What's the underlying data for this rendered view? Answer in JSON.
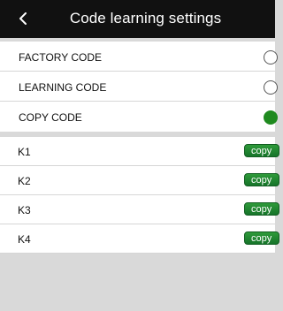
{
  "header": {
    "title": "Code learning settings",
    "back_icon": "chevron-left-icon"
  },
  "code_modes": [
    {
      "label": "FACTORY CODE",
      "selected": false
    },
    {
      "label": "LEARNING CODE",
      "selected": false
    },
    {
      "label": "COPY CODE",
      "selected": true
    }
  ],
  "keys": [
    {
      "label": "K1",
      "button": "copy"
    },
    {
      "label": "K2",
      "button": "copy"
    },
    {
      "label": "K3",
      "button": "copy"
    },
    {
      "label": "K4",
      "button": "copy"
    }
  ],
  "colors": {
    "header_bg": "#111111",
    "accent_green": "#1f8a1f",
    "page_bg": "#d9d9d9"
  }
}
